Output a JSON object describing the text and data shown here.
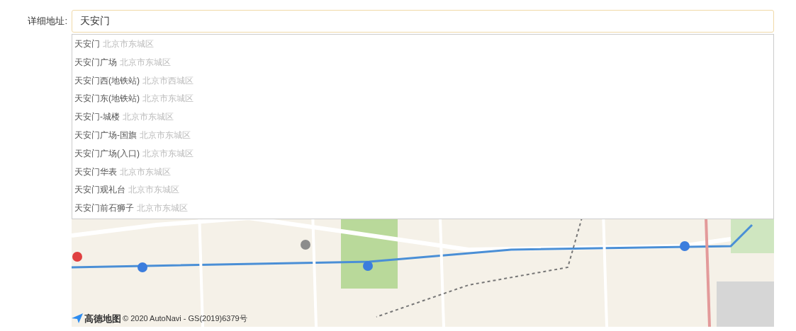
{
  "address_field": {
    "label": "详细地址:",
    "value": "天安门"
  },
  "suggestions": [
    {
      "name": "天安门",
      "district": "北京市东城区"
    },
    {
      "name": "天安门广场",
      "district": "北京市东城区"
    },
    {
      "name": "天安门西(地铁站)",
      "district": "北京市西城区"
    },
    {
      "name": "天安门东(地铁站)",
      "district": "北京市东城区"
    },
    {
      "name": "天安门-城楼",
      "district": "北京市东城区"
    },
    {
      "name": "天安门广场-国旗",
      "district": "北京市东城区"
    },
    {
      "name": "天安门广场(入口)",
      "district": "北京市东城区"
    },
    {
      "name": "天安门华表",
      "district": "北京市东城区"
    },
    {
      "name": "天安门观礼台",
      "district": "北京市东城区"
    },
    {
      "name": "天安门前石狮子",
      "district": "北京市东城区"
    }
  ],
  "map": {
    "logo": "高德地图",
    "copyright": "© 2020 AutoNavi - GS(2019)6379号"
  }
}
